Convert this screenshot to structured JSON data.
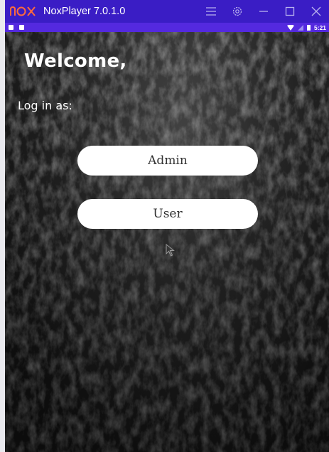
{
  "window": {
    "title": "NoxPlayer 7.0.1.0",
    "accent_color": "#3a1dc5",
    "icons": [
      "nox-logo",
      "menu-icon",
      "settings-icon",
      "minimize-icon",
      "maximize-icon",
      "close-icon"
    ]
  },
  "statusbar": {
    "time": "5:21",
    "color": "#5429df",
    "icons": [
      "notification-icon",
      "notification-icon",
      "wifi-icon",
      "signal-icon",
      "battery-icon"
    ]
  },
  "screen": {
    "welcome": "Welcome,",
    "login_prompt": "Log in as:",
    "buttons": {
      "admin": "Admin",
      "user": "User"
    }
  }
}
